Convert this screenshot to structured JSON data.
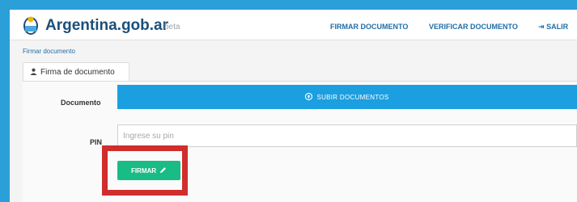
{
  "brand": {
    "name": "Argentina.gob.ar",
    "tag": "beta",
    "logo_icon": "argentina-seal-icon"
  },
  "nav": {
    "items": [
      {
        "label": "FIRMAR DOCUMENTO"
      },
      {
        "label": "VERIFICAR DOCUMENTO"
      },
      {
        "label": "SALIR",
        "icon": "sign-out-icon"
      }
    ]
  },
  "breadcrumb": "Firmar documento",
  "tab": {
    "label": "Firma de documento",
    "icon": "user-icon"
  },
  "form": {
    "document_label": "Documento",
    "upload_label": "SUBIR DOCUMENTOS",
    "upload_icon": "upload-circle-icon",
    "pin_label": "PIN",
    "pin_placeholder": "Ingrese su pin",
    "pin_value": "",
    "submit_label": "FIRMAR",
    "submit_icon": "pencil-icon"
  },
  "colors": {
    "page_background": "#2a9fd8",
    "brand_text": "#1a4f7a",
    "nav_link": "#1f6ea8",
    "upload_button": "#1c9fe0",
    "submit_button": "#1abc86",
    "highlight_border": "#d02d2d"
  }
}
